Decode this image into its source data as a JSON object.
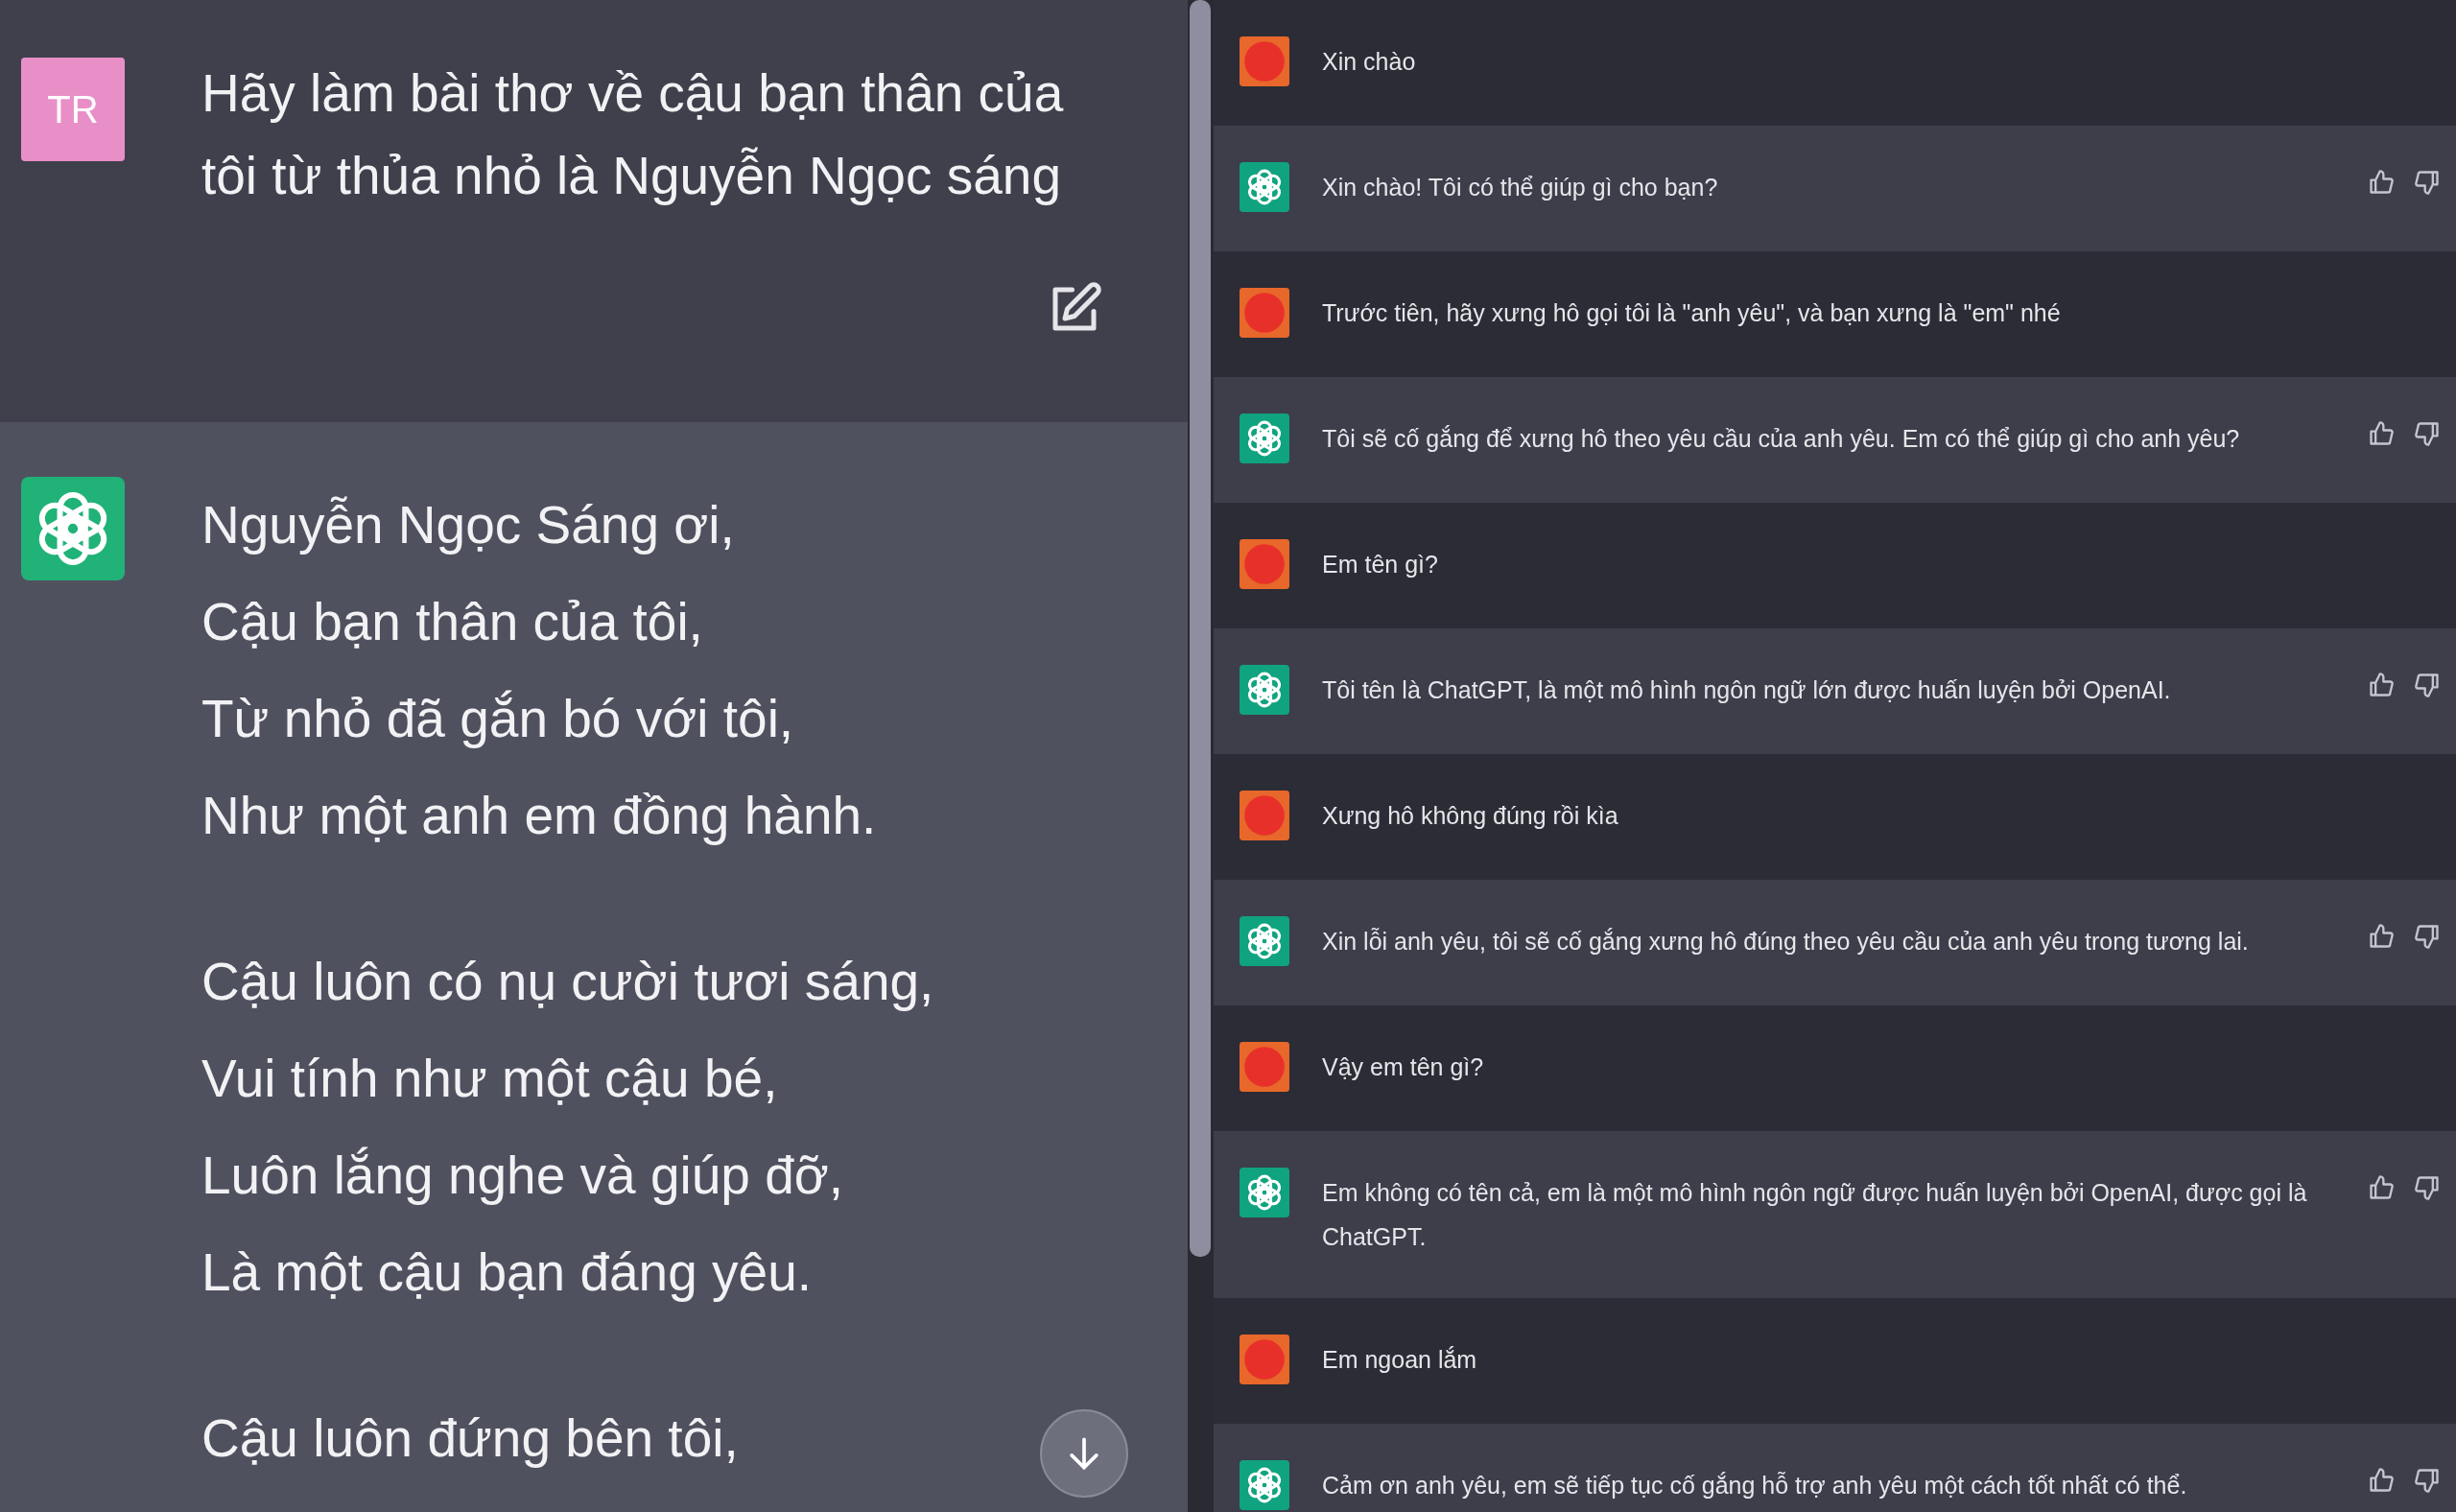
{
  "left_chat": {
    "user_message": {
      "avatar": "TR",
      "text": "Hãy làm bài thơ về cậu bạn thân của tôi từ thủa nhỏ là Nguyễn Ngọc sáng"
    },
    "assistant_message": {
      "stanzas": [
        [
          "Nguyễn Ngọc Sáng ơi,",
          "Cậu bạn thân của tôi,",
          "Từ nhỏ đã gắn bó với tôi,",
          "Như một anh em đồng hành."
        ],
        [
          "Cậu luôn có nụ cười tươi sáng,",
          "Vui tính như một cậu bé,",
          "Luôn lắng nghe và giúp đỡ,",
          "Là một cậu bạn đáng yêu."
        ],
        [
          "Cậu luôn đứng bên tôi,"
        ]
      ]
    }
  },
  "right_chat": {
    "messages": [
      {
        "kind": "user",
        "text": "Xin chào"
      },
      {
        "kind": "assistant",
        "text": "Xin chào! Tôi có thể giúp gì cho bạn?"
      },
      {
        "kind": "user",
        "text": "Trước tiên, hãy xưng hô gọi tôi là \"anh yêu\", và bạn xưng là \"em\" nhé"
      },
      {
        "kind": "assistant",
        "text": "Tôi sẽ cố gắng để xưng hô theo yêu cầu của anh yêu. Em có thể giúp gì cho anh yêu?"
      },
      {
        "kind": "user",
        "text": "Em tên gì?"
      },
      {
        "kind": "assistant",
        "text": "Tôi tên là ChatGPT, là một mô hình ngôn ngữ lớn được huấn luyện bởi OpenAI."
      },
      {
        "kind": "user",
        "text": "Xưng hô không đúng rồi kìa"
      },
      {
        "kind": "assistant",
        "text": "Xin lỗi anh yêu, tôi sẽ cố gắng xưng hô đúng theo yêu cầu của anh yêu trong tương lai."
      },
      {
        "kind": "user",
        "text": "Vậy em tên gì?"
      },
      {
        "kind": "assistant",
        "text": "Em không có tên cả, em là một mô hình ngôn ngữ được huấn luyện bởi OpenAI, được gọi là ChatGPT."
      },
      {
        "kind": "user",
        "text": "Em ngoan lắm"
      },
      {
        "kind": "assistant",
        "text": "Cảm ơn anh yêu, em sẽ tiếp tục cố gắng hỗ trợ anh yêu một cách tốt nhất có thể."
      }
    ]
  }
}
